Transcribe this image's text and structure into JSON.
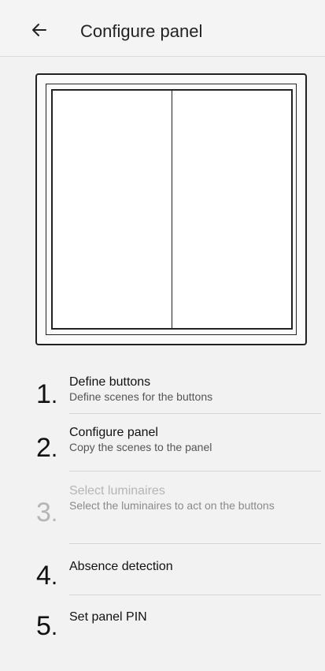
{
  "header": {
    "title": "Configure panel",
    "back_icon": "arrow-left-icon"
  },
  "panel": {
    "buttons": [
      "left",
      "right"
    ]
  },
  "steps": [
    {
      "number": "1",
      "title": "Define buttons",
      "subtitle": "Define scenes for the buttons",
      "enabled": true
    },
    {
      "number": "2",
      "title": "Configure panel",
      "subtitle": "Copy the scenes to the panel",
      "enabled": true
    },
    {
      "number": "3",
      "title": "Select luminaires",
      "subtitle": "Select the luminaires to act on the buttons",
      "enabled": false
    },
    {
      "number": "4",
      "title": "Absence detection",
      "subtitle": "",
      "enabled": true
    },
    {
      "number": "5",
      "title": "Set panel PIN",
      "subtitle": "",
      "enabled": true
    }
  ],
  "colors": {
    "background": "#f2f2f2",
    "disabled_text": "#b5b5b5"
  }
}
